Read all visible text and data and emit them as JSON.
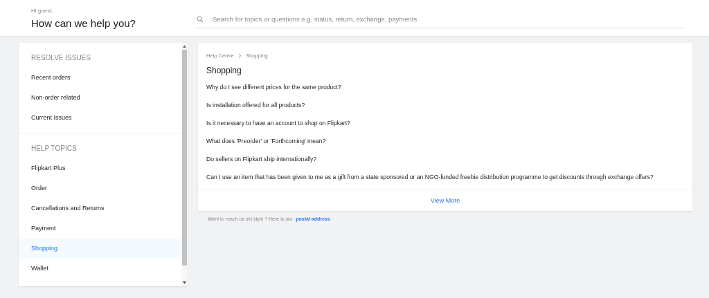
{
  "header": {
    "greeting": "Hi guest,",
    "title": "How can we help you?",
    "search": {
      "placeholder": "Search for topics or questions e.g. status, return, exchange, payments"
    }
  },
  "sidebar": {
    "sections": [
      {
        "heading": "RESOLVE ISSUES",
        "items": [
          {
            "label": "Recent orders",
            "selected": false
          },
          {
            "label": "Non-order related",
            "selected": false
          },
          {
            "label": "Current Issues",
            "selected": false
          }
        ]
      },
      {
        "heading": "HELP TOPICS",
        "items": [
          {
            "label": "Flipkart Plus",
            "selected": false
          },
          {
            "label": "Order",
            "selected": false
          },
          {
            "label": "Cancellations and Returns",
            "selected": false
          },
          {
            "label": "Payment",
            "selected": false
          },
          {
            "label": "Shopping",
            "selected": true
          },
          {
            "label": "Wallet",
            "selected": false
          }
        ]
      }
    ]
  },
  "content": {
    "breadcrumb": [
      "Help Centre",
      "Shopping"
    ],
    "title": "Shopping",
    "questions": [
      "Why do I see different prices for the same product?",
      "Is installation offered for all products?",
      "Is it necessary to have an account to shop on Flipkart?",
      "What does 'Preorder' or 'Forthcoming' mean?",
      "Do sellers on Flipkart ship internationally?",
      "Can I use an item that has been given to me as a gift from a state sponsored or an NGO-funded freebie distribution programme to get discounts through exchange offers?"
    ],
    "view_more": "View More"
  },
  "footer": {
    "text": "Want to reach us old style ? Here is our",
    "link": "postal address"
  }
}
